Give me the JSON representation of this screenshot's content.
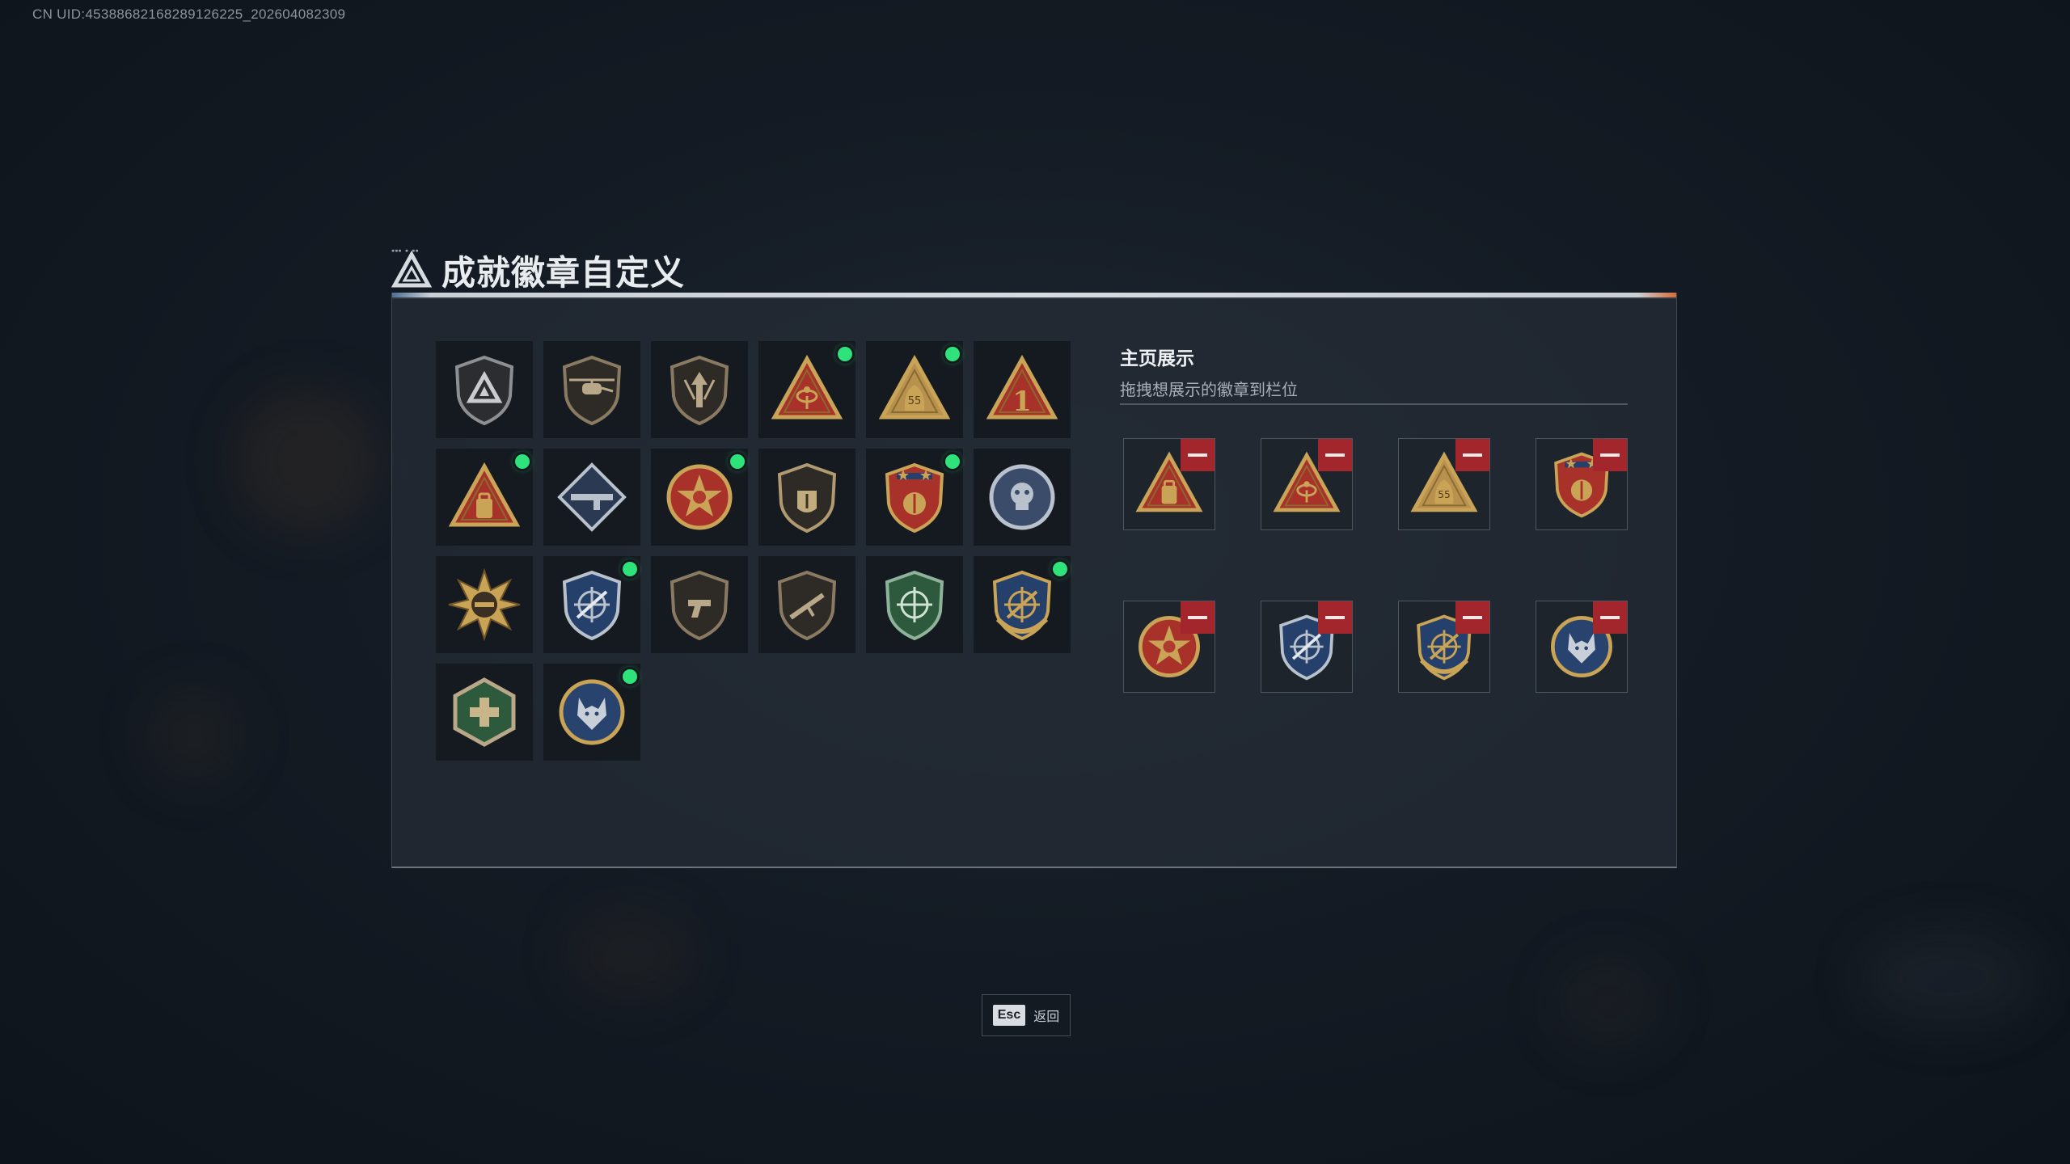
{
  "uid_text": "CN UID:4538868216828912​6225_202604082309",
  "title": "成就徽章自定义",
  "display": {
    "title": "主页展示",
    "subtitle": "拖拽想展示的徽章到栏位"
  },
  "esc": {
    "key": "Esc",
    "label": "返回"
  },
  "colors": {
    "new_dot": "#2ee37a",
    "remove": "#a3262c",
    "panel": "#262d36"
  },
  "badges": [
    {
      "icon": "triangle-logo-shield-badge-icon",
      "new": false
    },
    {
      "icon": "helicopter-shield-badge-icon",
      "new": false
    },
    {
      "icon": "arrow-shield-badge-icon",
      "new": false
    },
    {
      "icon": "radar-triangle-badge-icon",
      "new": true
    },
    {
      "icon": "bag-55-triangle-badge-icon",
      "new": true
    },
    {
      "icon": "number-one-triangle-badge-icon",
      "new": false
    },
    {
      "icon": "backpack-triangle-badge-icon",
      "new": true
    },
    {
      "icon": "rifle-diamond-badge-icon",
      "new": false
    },
    {
      "icon": "star-medal-badge-icon",
      "new": true
    },
    {
      "icon": "hand-shield-badge-icon",
      "new": false
    },
    {
      "icon": "gold-shield-stars-badge-icon",
      "new": true
    },
    {
      "icon": "skull-silver-badge-icon",
      "new": false
    },
    {
      "icon": "star-burst-badge-icon",
      "new": false
    },
    {
      "icon": "crosshair-blue-shield-badge-icon",
      "new": true
    },
    {
      "icon": "pistol-bronze-shield-badge-icon",
      "new": false
    },
    {
      "icon": "rifle-bronze-shield-badge-icon",
      "new": false
    },
    {
      "icon": "crosshair-green-shield-badge-icon",
      "new": false
    },
    {
      "icon": "crosshair-gold-wreath-badge-icon",
      "new": true
    },
    {
      "icon": "medic-hexagon-badge-icon",
      "new": false
    },
    {
      "icon": "wolf-blue-badge-icon",
      "new": true
    }
  ],
  "showcase": [
    {
      "icon": "backpack-triangle-badge-icon"
    },
    {
      "icon": "radar-triangle-badge-icon"
    },
    {
      "icon": "bag-55-triangle-badge-icon"
    },
    {
      "icon": "gold-shield-stars-badge-icon"
    },
    {
      "icon": "star-medal-badge-icon"
    },
    {
      "icon": "crosshair-blue-shield-badge-icon"
    },
    {
      "icon": "crosshair-gold-wreath-badge-icon"
    },
    {
      "icon": "wolf-blue-badge-icon"
    }
  ]
}
